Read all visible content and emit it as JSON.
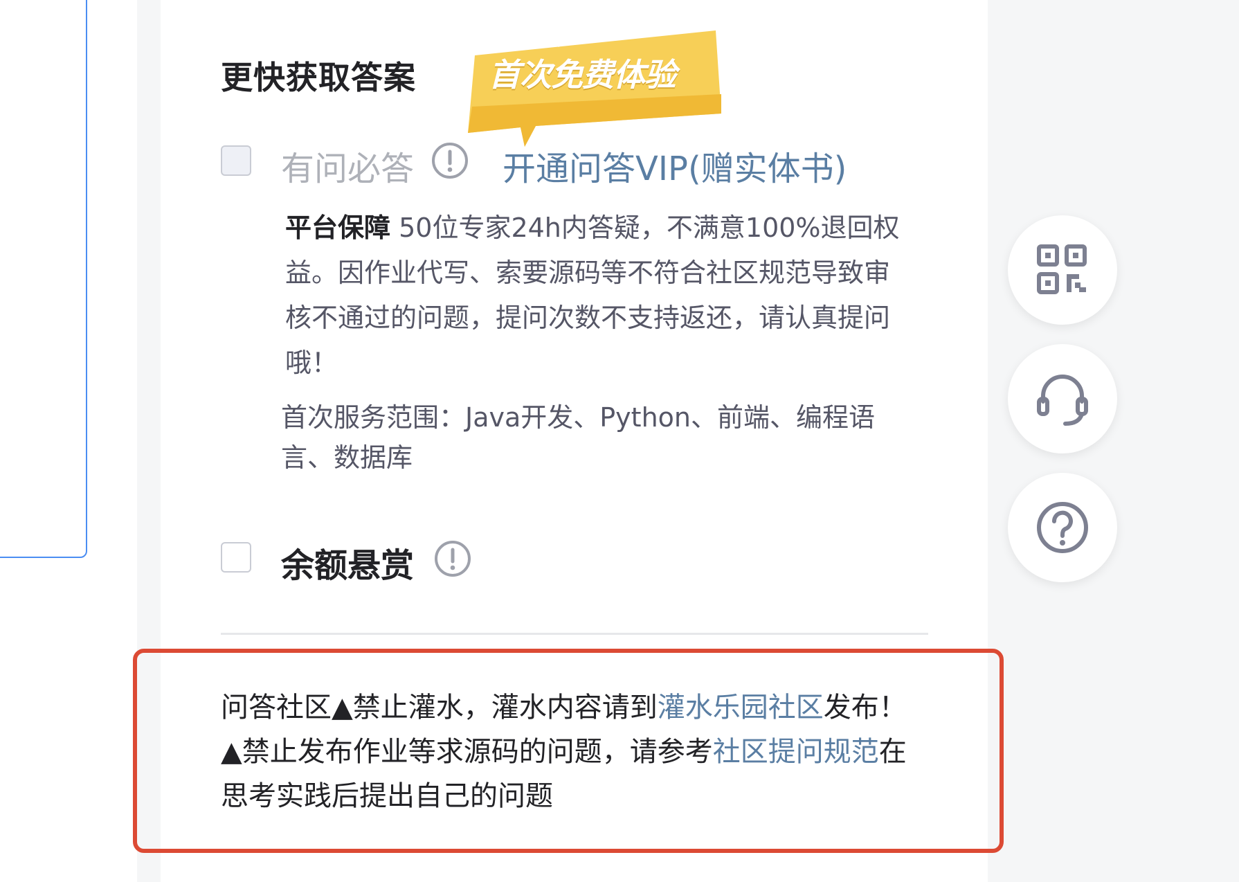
{
  "section": {
    "title": "更快获取答案",
    "promo_badge": "首次免费体验"
  },
  "options": {
    "qa": {
      "label": "有问必答",
      "vip_link": "开通问答VIP(赠实体书)",
      "desc_strong": "平台保障",
      "desc_rest": " 50位专家24h内答疑，不满意100%退回权益。因作业代写、索要源码等不符合社区规范导致审核不通过的问题，提问次数不支持返还，请认真提问哦！",
      "scope": "首次服务范围：Java开发、Python、前端、编程语言、数据库"
    },
    "bounty": {
      "label": "余额悬赏"
    }
  },
  "notice": {
    "part1": "问答社区▲禁止灌水，灌水内容请到",
    "link1": "灌水乐园社区",
    "part2": "发布！▲禁止发布作业等求源码的问题，请参考",
    "link2": "社区提问规范",
    "part3": "在思考实践后提出自己的问题"
  },
  "float_buttons": [
    "qrcode-icon",
    "headset-icon",
    "help-icon"
  ],
  "colors": {
    "link": "#5a7ea3",
    "notice_border": "#dc4a34",
    "badge": "#f7cf57"
  }
}
